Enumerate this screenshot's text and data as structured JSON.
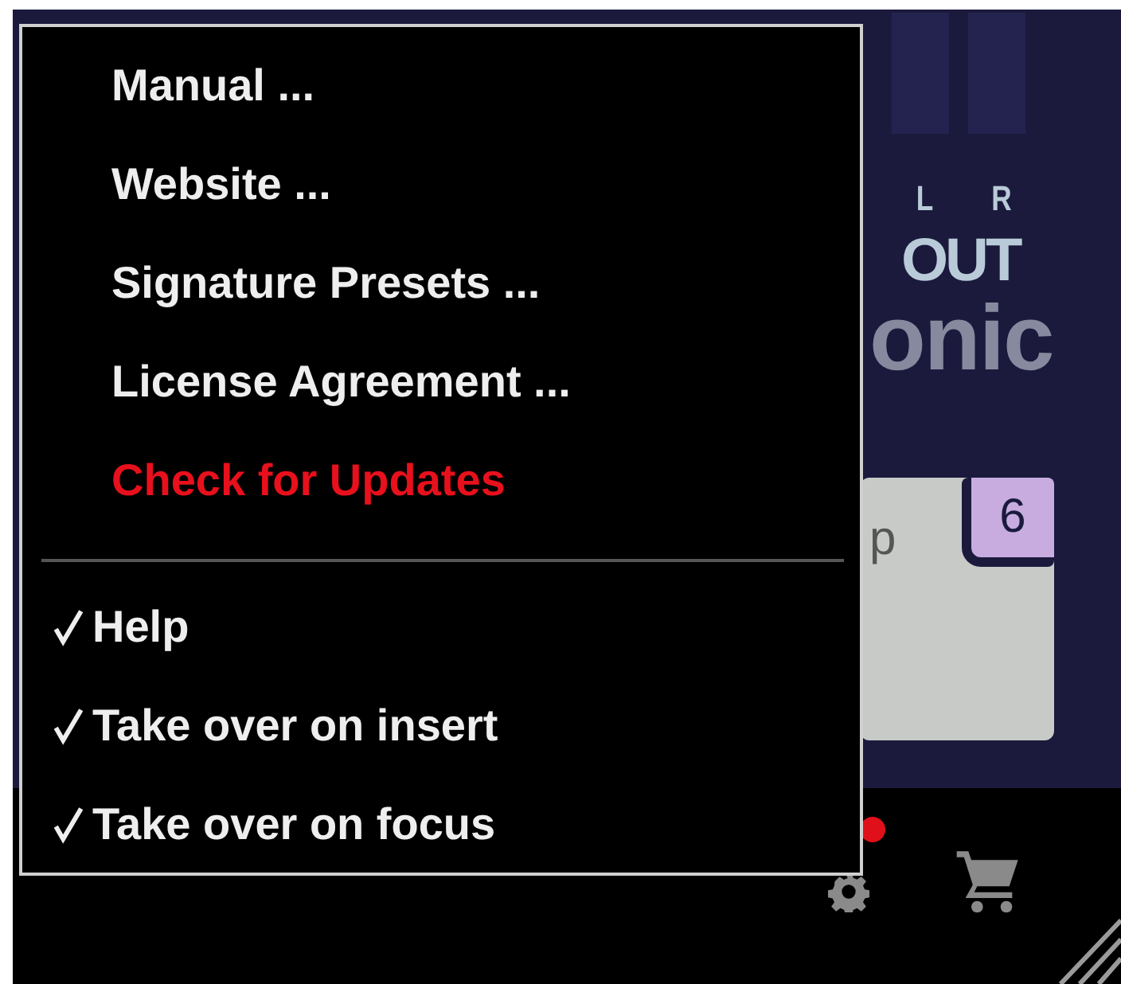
{
  "menu": {
    "items": [
      {
        "label": "Manual ...",
        "kind": "link"
      },
      {
        "label": "Website ...",
        "kind": "link"
      },
      {
        "label": "Signature Presets ...",
        "kind": "link"
      },
      {
        "label": "License Agreement ...",
        "kind": "link"
      },
      {
        "label": "Check for Updates",
        "kind": "update"
      }
    ],
    "toggles": [
      {
        "label": "Help",
        "checked": true
      },
      {
        "label": "Take over on insert",
        "checked": true
      },
      {
        "label": "Take over on focus",
        "checked": true
      }
    ]
  },
  "meter": {
    "channels": [
      "L",
      "R"
    ],
    "label": "OUT"
  },
  "brand": {
    "text": "onic"
  },
  "panel": {
    "tab_text": "p",
    "badge": "6"
  },
  "footer": {
    "notification": true
  }
}
